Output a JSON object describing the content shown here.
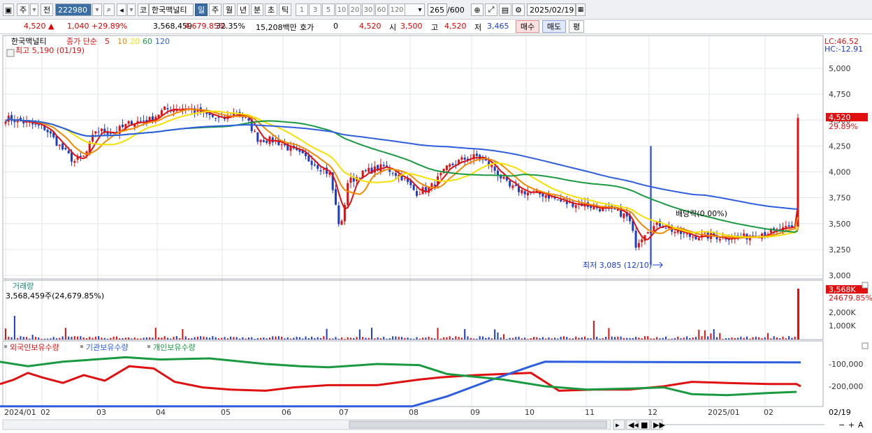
{
  "toolbar": {
    "market": "주",
    "prev": "전",
    "code": "222980",
    "name_prefix": "코",
    "name": "한국맥널티",
    "periods": [
      "일",
      "주",
      "월",
      "년",
      "분",
      "초",
      "틱"
    ],
    "active_period": "일",
    "intervals": [
      "1",
      "3",
      "5",
      "10",
      "20",
      "30",
      "60",
      "120"
    ],
    "count": "265",
    "count_total": "/600",
    "date": "2025/02/19"
  },
  "quote": {
    "price": "4,520",
    "change": "1,040",
    "change_pct": "+29.89%",
    "volume": "3,568,459",
    "vol_ratio": "4,679.85%",
    "turnover_pct": "32.35%",
    "amount": "15,208백만",
    "hoga_label": "호가",
    "hoga_val": "0",
    "hoga_price": "4,520",
    "open_label": "시",
    "open": "3,500",
    "high_label": "고",
    "high": "4,520",
    "low_label": "저",
    "low": "3,465",
    "buy": "매수",
    "sell": "매도",
    "flat": "평"
  },
  "price_panel": {
    "title": "한국맥널티",
    "ma_label": "종가 단순",
    "ma_periods": [
      "5",
      "10",
      "20",
      "60",
      "120"
    ],
    "ma_colors": [
      "#e01010",
      "#f08a00",
      "#f5e000",
      "#1a9a40",
      "#2d5ee0"
    ],
    "high_note": "최고 5,190 (01/19)",
    "low_note": "최저 3,085 (12/10)",
    "dividend_note": "배당락(0.00%)",
    "lc": "LC:46.52",
    "hc": "HC:-12.91",
    "yticks": [
      "5,000",
      "4,750",
      "4,500",
      "4,250",
      "4,000",
      "3,750",
      "3,500",
      "3,250",
      "3,000"
    ],
    "current_price": "4,520",
    "current_pct": "29.89%"
  },
  "volume_panel": {
    "title": "거래량",
    "value": "3,568,459주(24,679.85%)",
    "yticks": [
      "2,000K",
      "1,000K"
    ],
    "current": "3,568K",
    "current_pct": "24679.85%"
  },
  "holding_panel": {
    "legends": [
      "외국인보유수량",
      "기관보유수량",
      "개인보유수량"
    ],
    "colors": [
      "#e01010",
      "#2d5ee0",
      "#1a9a40"
    ],
    "yticks": [
      "-100,000",
      "-200,000"
    ]
  },
  "xaxis": {
    "labels": [
      "2024/01",
      "02",
      "03",
      "04",
      "05",
      "06",
      "07",
      "08",
      "09",
      "10",
      "11",
      "12",
      "2025/01",
      "02"
    ],
    "end_label": "02/19"
  },
  "colors": {
    "up": "#e01010",
    "down": "#1a3dcc",
    "accent": "#3a6ea5"
  }
}
